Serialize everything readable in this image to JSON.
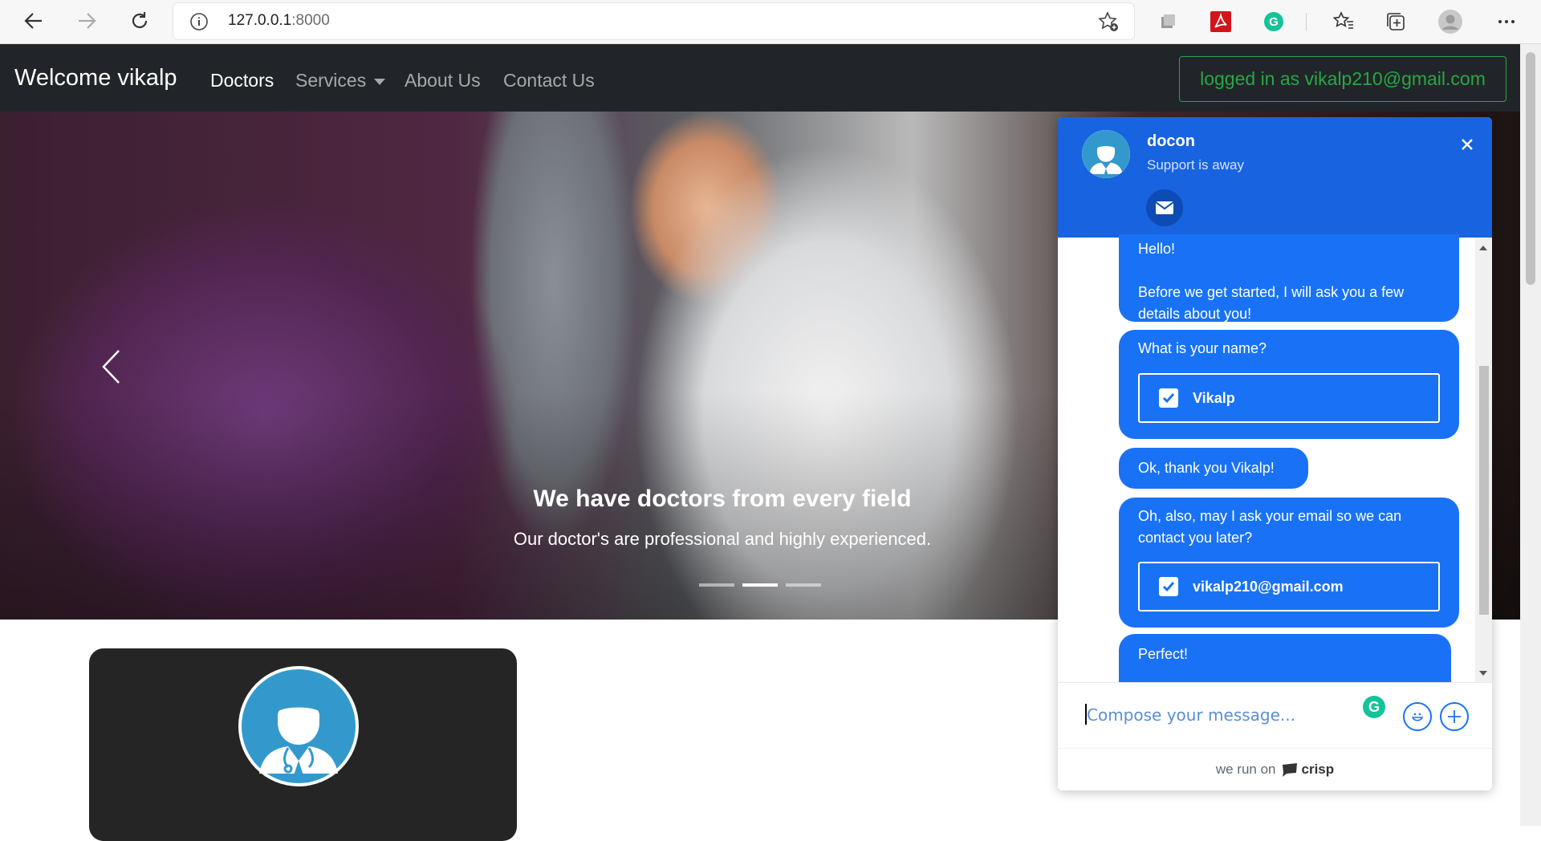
{
  "browser": {
    "url_host": "127.0.0.1",
    "url_port": ":8000"
  },
  "navbar": {
    "brand": "Welcome vikalp",
    "links": [
      {
        "label": "Doctors"
      },
      {
        "label": "Services"
      },
      {
        "label": "About Us"
      },
      {
        "label": "Contact Us"
      }
    ],
    "login_label": "logged in as vikalp210@gmail.com"
  },
  "hero": {
    "title": "We have doctors from every field",
    "subtitle": "Our doctor's are professional and highly experienced.",
    "slides_total": 3,
    "active_slide": 2
  },
  "chat": {
    "title": "docon",
    "status": "Support is away",
    "messages": {
      "m1_line1": "Hello!",
      "m1_line2": "Before we get started, I will ask you a few details about you!",
      "m2_text": "What is your name?",
      "m2_answer": "Vikalp",
      "m3_text": "Ok, thank you Vikalp!",
      "m4_text": "Oh, also, may I ask your email so we can contact you later?",
      "m4_answer": "vikalp210@gmail.com",
      "m5_text": "Perfect!"
    },
    "compose_placeholder": "Compose your message...",
    "footer_prefix": "we run on",
    "footer_brand": "crisp"
  },
  "colors": {
    "chat_accent": "#1972f5",
    "chat_header": "#1863e0",
    "login_green": "#28a745",
    "navbar_bg": "#212529"
  }
}
